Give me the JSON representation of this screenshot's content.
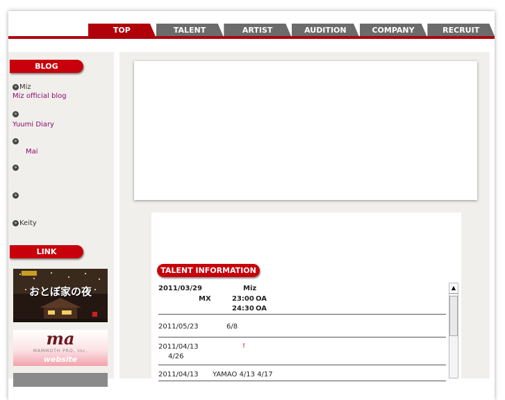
{
  "nav": {
    "items": [
      {
        "label": "TOP"
      },
      {
        "label": "TALENT"
      },
      {
        "label": "ARTIST"
      },
      {
        "label": "AUDITION"
      },
      {
        "label": "COMPANY"
      },
      {
        "label": "RECRUIT"
      }
    ]
  },
  "sidebar": {
    "blog_heading": "BLOG",
    "blog_items": [
      {
        "name": "Miz",
        "link": "Miz official blog"
      },
      {
        "name": "",
        "link": "Yuumi Diary"
      },
      {
        "name": "",
        "link": "Mai"
      },
      {
        "name": "",
        "link": ""
      },
      {
        "name": "",
        "link": ""
      },
      {
        "name": "Keity",
        "link": ""
      }
    ],
    "link_heading": "LINK",
    "banner1_text": "おとぼ家の夜",
    "banner2_logo": "ma",
    "banner2_company": "MAMMOTH PRO, Inc.",
    "banner2_sub": "website"
  },
  "talent_info": {
    "heading": "TALENT INFORMATION",
    "entries": [
      {
        "date": "2011/03/29",
        "name": "Miz",
        "channel": "MX",
        "time1": "23:00",
        "oa1": "OA",
        "time2": "24:30",
        "oa2": "OA"
      },
      {
        "date": "2011/05/23",
        "text": "6/8"
      },
      {
        "date": "2011/04/13",
        "mark": "!",
        "text": "4/26"
      },
      {
        "date": "2011/04/13",
        "text": "YAMAO 4/13 4/17"
      }
    ]
  },
  "colors": {
    "accent": "#c8000c",
    "nav_inactive": "#6b6b6b",
    "panel_bg": "#f1efeb",
    "link": "#8a0a6e"
  }
}
